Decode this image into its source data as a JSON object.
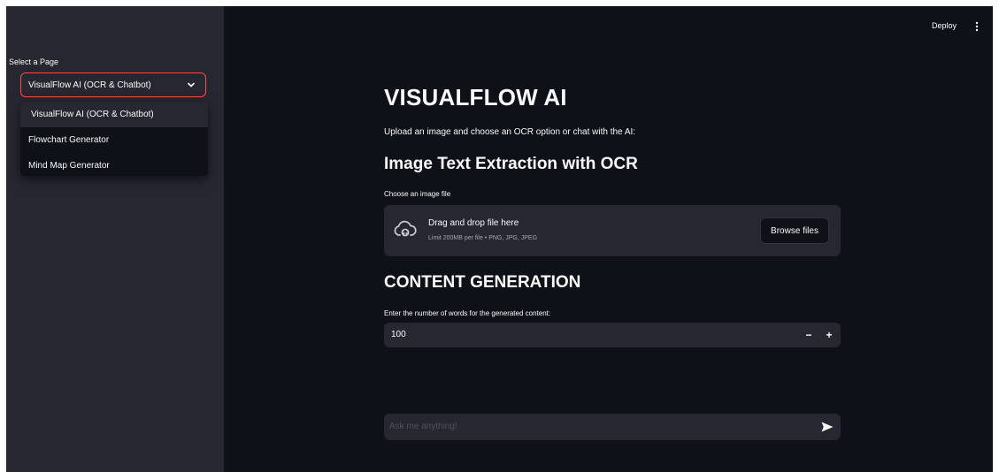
{
  "sidebar": {
    "select_label": "Select a Page",
    "selected_value": "VisualFlow AI (OCR & Chatbot)",
    "options": [
      "VisualFlow AI (OCR & Chatbot)",
      "Flowchart Generator",
      "Mind Map Generator"
    ]
  },
  "topbar": {
    "deploy_label": "Deploy"
  },
  "main": {
    "title": "VISUALFLOW AI",
    "intro": "Upload an image and choose an OCR option or chat with the AI:",
    "ocr_heading": "Image Text Extraction with OCR",
    "uploader": {
      "label": "Choose an image file",
      "drop_text": "Drag and drop file here",
      "limit_text": "Limit 200MB per file • PNG, JPG, JPEG",
      "browse_label": "Browse files"
    },
    "content_heading": "CONTENT GENERATION",
    "number_input": {
      "label": "Enter the number of words for the generated content:",
      "value": "100",
      "minus": "−",
      "plus": "+"
    },
    "chat": {
      "placeholder": "Ask me anything!"
    }
  },
  "colors": {
    "background": "#0e1117",
    "sidebar": "#262730",
    "accent": "#ff4b4b",
    "text": "#fafafa"
  },
  "icons": {
    "dropdown": "chevron-down-icon",
    "menu": "vertical-ellipsis-icon",
    "upload": "cloud-upload-icon",
    "send": "send-icon"
  }
}
